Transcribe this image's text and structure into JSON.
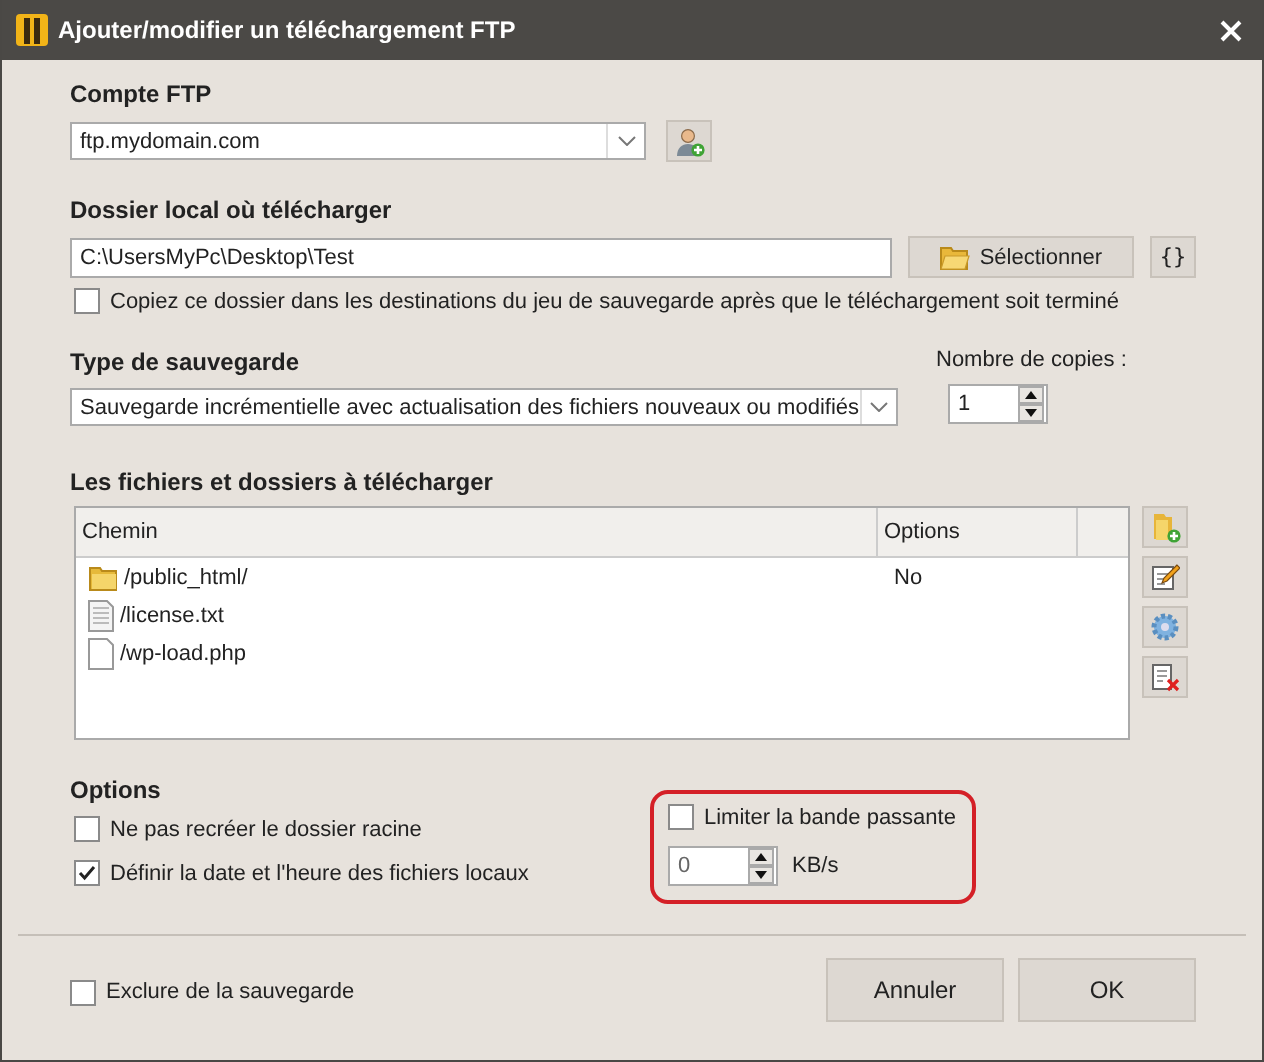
{
  "window": {
    "title": "Ajouter/modifier un téléchargement FTP"
  },
  "ftp_account": {
    "label": "Compte FTP",
    "value": "ftp.mydomain.com"
  },
  "local_folder": {
    "label": "Dossier local où télécharger",
    "value": "C:\\UsersMyPc\\Desktop\\Test",
    "select_button": "Sélectionner",
    "variables_button": "{}",
    "copy_option": {
      "label": "Copiez ce dossier dans les destinations du jeu de sauvegarde après que le téléchargement soit terminé",
      "checked": false
    }
  },
  "backup_type": {
    "label": "Type de sauvegarde",
    "value": "Sauvegarde incrémentielle avec actualisation des fichiers nouveaux ou modifiés"
  },
  "copies": {
    "label": "Nombre de copies :",
    "value": "1"
  },
  "files": {
    "label": "Les fichiers et dossiers à télécharger",
    "columns": [
      "Chemin",
      "Options"
    ],
    "rows": [
      {
        "kind": "folder",
        "path": "/public_html/",
        "options": "No"
      },
      {
        "kind": "text-file",
        "path": "/license.txt"
      },
      {
        "kind": "file",
        "path": "/wp-load.php"
      }
    ]
  },
  "options": {
    "label": "Options",
    "checkboxes": [
      {
        "label": "Ne pas recréer le dossier racine",
        "checked": false
      },
      {
        "label": "Définir la date et l'heure des fichiers locaux",
        "checked": true
      }
    ],
    "bandwidth": {
      "label": "Limiter la bande passante",
      "checked": false,
      "value": "0",
      "unit": "KB/s",
      "highlighted": true
    }
  },
  "exclude": {
    "label": "Exclure de la sauvegarde",
    "checked": false
  },
  "buttons": [
    "Annuler",
    "OK"
  ]
}
